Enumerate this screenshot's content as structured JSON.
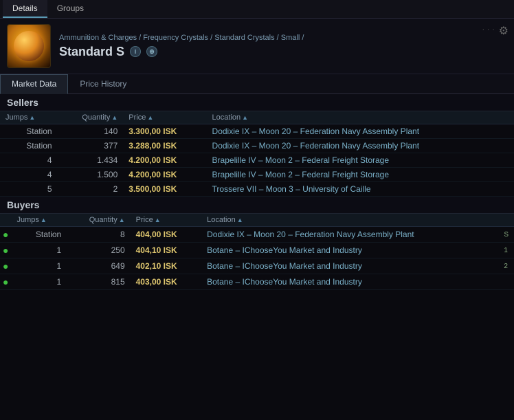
{
  "topTabs": [
    {
      "label": "Details",
      "active": true
    },
    {
      "label": "Groups",
      "active": false
    }
  ],
  "header": {
    "breadcrumb": "Ammunition & Charges / Frequency Crystals / Standard Crystals / Small /",
    "itemName": "Standard S",
    "infoBtn": "i",
    "compareBtn": "⊕",
    "settingsIcon": "⚙"
  },
  "subTabs": [
    {
      "label": "Market Data",
      "active": true
    },
    {
      "label": "Price History",
      "active": false
    }
  ],
  "sellers": {
    "title": "Sellers",
    "columns": [
      {
        "label": "Jumps",
        "sort": "▲"
      },
      {
        "label": "Quantity",
        "sort": "▲"
      },
      {
        "label": "Price",
        "sort": "▲"
      },
      {
        "label": "Location",
        "sort": "▲"
      }
    ],
    "rows": [
      {
        "jumps": "Station",
        "qty": "140",
        "price": "3.300,00 ISK",
        "location": "Dodixie IX – Moon 20 – Federation Navy Assembly Plant"
      },
      {
        "jumps": "Station",
        "qty": "377",
        "price": "3.288,00 ISK",
        "location": "Dodixie IX – Moon 20 – Federation Navy Assembly Plant"
      },
      {
        "jumps": "4",
        "qty": "1.434",
        "price": "4.200,00 ISK",
        "location": "Brapelille IV – Moon 2 – Federal Freight Storage"
      },
      {
        "jumps": "4",
        "qty": "1.500",
        "price": "4.200,00 ISK",
        "location": "Brapelille IV – Moon 2 – Federal Freight Storage"
      },
      {
        "jumps": "5",
        "qty": "2",
        "price": "3.500,00 ISK",
        "location": "Trossere VII – Moon 3 – University of Caille"
      }
    ]
  },
  "buyers": {
    "title": "Buyers",
    "columns": [
      {
        "label": "Jumps",
        "sort": "▲"
      },
      {
        "label": "Quantity",
        "sort": "▲"
      },
      {
        "label": "Price",
        "sort": "▲"
      },
      {
        "label": "Location",
        "sort": "▲"
      }
    ],
    "rows": [
      {
        "indicator": "●",
        "jumps": "Station",
        "qty": "8",
        "price": "404,00 ISK",
        "location": "Dodixie IX – Moon 20 – Federation Navy Assembly Plant",
        "range": "S"
      },
      {
        "indicator": "●",
        "jumps": "1",
        "qty": "250",
        "price": "404,10 ISK",
        "location": "Botane – IChooseYou Market and Industry",
        "range": "1"
      },
      {
        "indicator": "●",
        "jumps": "1",
        "qty": "649",
        "price": "402,10 ISK",
        "location": "Botane – IChooseYou Market and Industry",
        "range": "2"
      },
      {
        "indicator": "●",
        "jumps": "1",
        "qty": "815",
        "price": "403,00 ISK",
        "location": "Botane – IChooseYou Market and Industry",
        "range": ""
      }
    ]
  }
}
